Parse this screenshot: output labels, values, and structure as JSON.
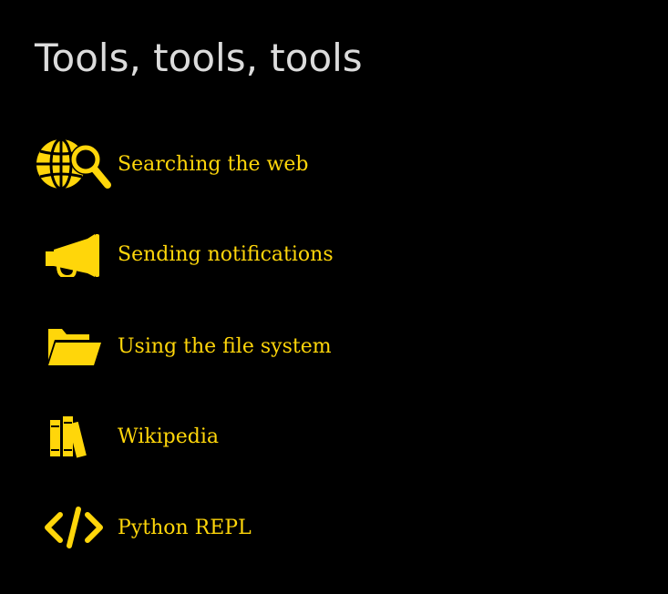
{
  "slide": {
    "title": "Tools, tools, tools",
    "accent_color": "#ffd60a",
    "title_color": "#dcdcdc",
    "items": [
      {
        "label": "Searching the web",
        "icon": "globe-search-icon"
      },
      {
        "label": "Sending notifications",
        "icon": "megaphone-icon"
      },
      {
        "label": "Using the file system",
        "icon": "folder-open-icon"
      },
      {
        "label": "Wikipedia",
        "icon": "books-icon"
      },
      {
        "label": "Python REPL",
        "icon": "code-icon"
      }
    ]
  }
}
